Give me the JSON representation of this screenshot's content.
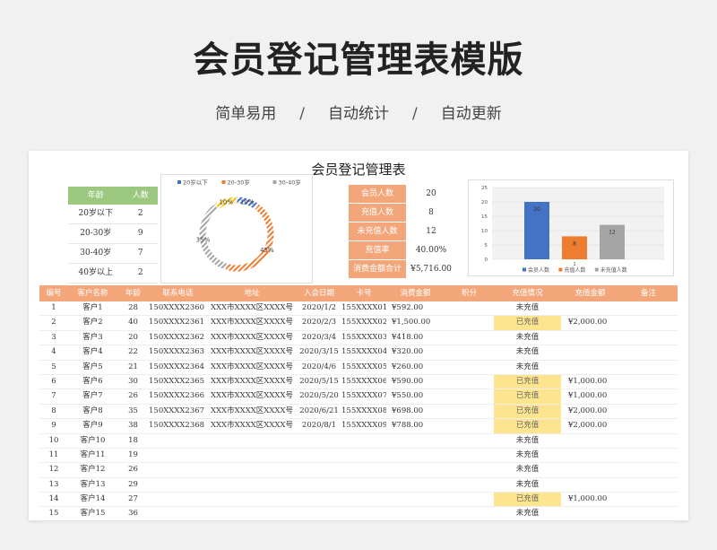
{
  "header": {
    "title": "会员登记管理表模版",
    "features": [
      "简单易用",
      "自动统计",
      "自动更新"
    ],
    "separator": "/"
  },
  "sheet": {
    "title": "会员登记管理表"
  },
  "age_table": {
    "headers": [
      "年龄",
      "人数"
    ],
    "rows": [
      {
        "label": "20岁以下",
        "count": "2"
      },
      {
        "label": "20-30岁",
        "count": "9"
      },
      {
        "label": "30-40岁",
        "count": "7"
      },
      {
        "label": "40岁以上",
        "count": "2"
      }
    ]
  },
  "summary": {
    "rows": [
      {
        "label": "会员人数",
        "value": "20"
      },
      {
        "label": "充值人数",
        "value": "8"
      },
      {
        "label": "未充值人数",
        "value": "12"
      },
      {
        "label": "充值率",
        "value": "40.00%"
      },
      {
        "label": "消费金额合计",
        "value": "¥5,716.00"
      }
    ]
  },
  "chart_data": [
    {
      "type": "pie",
      "title": "",
      "legend_position": "top",
      "categories": [
        "20岁以下",
        "20-30岁",
        "30-40岁",
        "40岁以上"
      ],
      "values": [
        10,
        45,
        35,
        10
      ],
      "labels": [
        "10%",
        "45%",
        "35%",
        "10%"
      ],
      "colors": [
        "#4472c4",
        "#ed7d31",
        "#a5a5a5",
        "#ffc000"
      ]
    },
    {
      "type": "bar",
      "title": "",
      "legend_position": "bottom",
      "categories": [
        "会员人数",
        "充值人数",
        "未充值人数"
      ],
      "values": [
        20,
        8,
        12
      ],
      "colors": [
        "#4472c4",
        "#ed7d31",
        "#a5a5a5"
      ],
      "ylim": [
        0,
        25
      ],
      "yticks": [
        "25",
        "20",
        "15",
        "10",
        "5",
        "0"
      ],
      "x_tick_label": "1",
      "grid": true
    }
  ],
  "table": {
    "headers": [
      "编号",
      "客户名称",
      "年龄",
      "联系电话",
      "地址",
      "入会日期",
      "卡号",
      "消费金额",
      "积分",
      "充值情况",
      "充值金额",
      "备注"
    ],
    "rows": [
      [
        "1",
        "客户1",
        "28",
        "150XXXX2360",
        "XXX市XXXX区XXXX号",
        "2020/1/2",
        "155XXXX01",
        "¥592.00",
        "",
        "未充值",
        "",
        ""
      ],
      [
        "2",
        "客户2",
        "40",
        "150XXXX2361",
        "XXX市XXXX区XXXX号",
        "2020/2/3",
        "155XXXX02",
        "¥1,500.00",
        "",
        "已充值",
        "¥2,000.00",
        ""
      ],
      [
        "3",
        "客户3",
        "20",
        "150XXXX2362",
        "XXX市XXXX区XXXX号",
        "2020/3/4",
        "155XXXX03",
        "¥418.00",
        "",
        "未充值",
        "",
        ""
      ],
      [
        "4",
        "客户4",
        "22",
        "150XXXX2363",
        "XXX市XXXX区XXXX号",
        "2020/3/15",
        "155XXXX04",
        "¥320.00",
        "",
        "未充值",
        "",
        ""
      ],
      [
        "5",
        "客户5",
        "21",
        "150XXXX2364",
        "XXX市XXXX区XXXX号",
        "2020/4/6",
        "155XXXX05",
        "¥260.00",
        "",
        "未充值",
        "",
        ""
      ],
      [
        "6",
        "客户6",
        "30",
        "150XXXX2365",
        "XXX市XXXX区XXXX号",
        "2020/5/15",
        "155XXXX06",
        "¥590.00",
        "",
        "已充值",
        "¥1,000.00",
        ""
      ],
      [
        "7",
        "客户7",
        "26",
        "150XXXX2366",
        "XXX市XXXX区XXXX号",
        "2020/5/20",
        "155XXXX07",
        "¥550.00",
        "",
        "已充值",
        "¥1,000.00",
        ""
      ],
      [
        "8",
        "客户8",
        "35",
        "150XXXX2367",
        "XXX市XXXX区XXXX号",
        "2020/6/21",
        "155XXXX08",
        "¥698.00",
        "",
        "已充值",
        "¥2,000.00",
        ""
      ],
      [
        "9",
        "客户9",
        "38",
        "150XXXX2368",
        "XXX市XXXX区XXXX号",
        "2020/8/1",
        "155XXXX09",
        "¥788.00",
        "",
        "已充值",
        "¥2,000.00",
        ""
      ],
      [
        "10",
        "客户10",
        "18",
        "",
        "",
        "",
        "",
        "",
        "",
        "未充值",
        "",
        ""
      ],
      [
        "11",
        "客户11",
        "19",
        "",
        "",
        "",
        "",
        "",
        "",
        "未充值",
        "",
        ""
      ],
      [
        "12",
        "客户12",
        "26",
        "",
        "",
        "",
        "",
        "",
        "",
        "未充值",
        "",
        ""
      ],
      [
        "13",
        "客户13",
        "29",
        "",
        "",
        "",
        "",
        "",
        "",
        "未充值",
        "",
        ""
      ],
      [
        "14",
        "客户14",
        "27",
        "",
        "",
        "",
        "",
        "",
        "",
        "已充值",
        "¥1,000.00",
        ""
      ],
      [
        "15",
        "客户15",
        "36",
        "",
        "",
        "",
        "",
        "",
        "",
        "未充值",
        "",
        ""
      ]
    ],
    "charged_value": "已充值",
    "charged_color": "#fde58f"
  },
  "colors": {
    "header_orange": "#f4a67b",
    "header_green": "#9bc77e"
  }
}
